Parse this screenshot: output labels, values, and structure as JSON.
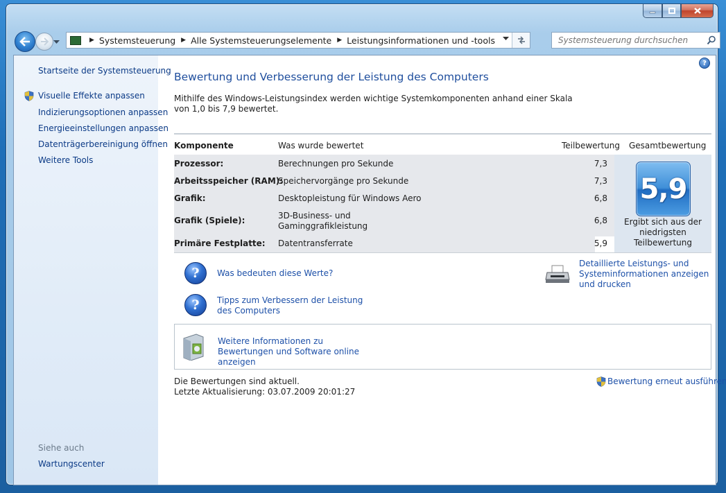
{
  "window": {
    "caption_buttons": {
      "minimize_icon": "minimize-icon",
      "maximize_icon": "maximize-icon",
      "close_icon": "close-icon"
    }
  },
  "navigation": {
    "breadcrumbs": [
      "Systemsteuerung",
      "Alle Systemsteuerungselemente",
      "Leistungsinformationen und -tools"
    ],
    "search_placeholder": "Systemsteuerung durchsuchen"
  },
  "sidebar": {
    "home": "Startseite der Systemsteuerung",
    "tasks": [
      "Visuelle Effekte anpassen",
      "Indizierungsoptionen anpassen",
      "Energieeinstellungen anpassen",
      "Datenträgerbereinigung öffnen",
      "Weitere Tools"
    ],
    "see_also_label": "Siehe auch",
    "see_also": [
      "Wartungscenter"
    ]
  },
  "main": {
    "help_label": "?",
    "title": "Bewertung und Verbesserung der Leistung des Computers",
    "description": "Mithilfe des Windows-Leistungsindex werden wichtige Systemkomponenten anhand einer Skala von 1,0 bis 7,9 bewertet.",
    "table": {
      "headers": [
        "Komponente",
        "Was wurde bewertet",
        "Teilbewertung",
        "Gesamtbewertung"
      ],
      "rows": [
        {
          "component": "Prozessor:",
          "rated": "Berechnungen pro Sekunde",
          "score": "7,3"
        },
        {
          "component": "Arbeitsspeicher (RAM):",
          "rated": "Speichervorgänge pro Sekunde",
          "score": "7,3"
        },
        {
          "component": "Grafik:",
          "rated": "Desktopleistung für Windows Aero",
          "score": "6,8"
        },
        {
          "component": "Grafik (Spiele):",
          "rated": "3D-Business- und Gaminggrafikleistung",
          "score": "6,8"
        },
        {
          "component": "Primäre Festplatte:",
          "rated": "Datentransferrate",
          "score": "5,9"
        }
      ],
      "overall_score": "5,9",
      "overall_note": "Ergibt sich aus der niedrigsten Teilbewertung"
    },
    "links": {
      "what_mean": "Was bedeuten diese Werte?",
      "tips": "Tipps zum Verbessern der Leistung des Computers",
      "details": "Detaillierte Leistungs- und Systeminformationen anzeigen und drucken",
      "more_info": "Weitere Informationen zu Bewertungen und Software online anzeigen"
    },
    "status_line1": "Die Bewertungen sind aktuell.",
    "status_line2": "Letzte Aktualisierung: 03.07.2009 20:01:27",
    "rerun": "Bewertung erneut ausführen"
  }
}
